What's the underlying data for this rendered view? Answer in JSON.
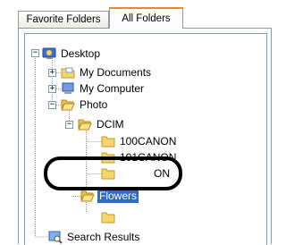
{
  "tabs": [
    {
      "label": "Favorite Folders",
      "active": false
    },
    {
      "label": "All Folders",
      "active": true
    }
  ],
  "tree": {
    "desktop": {
      "label": "Desktop",
      "icon": "desktop-icon",
      "expanded": true
    },
    "my_documents": {
      "label": "My Documents",
      "icon": "my-documents-folder-icon",
      "expanded": false
    },
    "my_computer": {
      "label": "My Computer",
      "icon": "computer-icon",
      "expanded": false
    },
    "photo": {
      "label": "Photo",
      "icon": "folder-open-icon",
      "expanded": true
    },
    "dcim": {
      "label": "DCIM",
      "icon": "folder-open-icon",
      "expanded": true
    },
    "canon100": {
      "label": "100CANON",
      "icon": "folder-icon"
    },
    "canon101": {
      "label": "101CANON",
      "icon": "folder-icon"
    },
    "canon102_partial": {
      "label": "ON",
      "icon": "folder-icon"
    },
    "flowers": {
      "label": "Flowers",
      "icon": "folder-open-icon",
      "selected": true
    },
    "hidden_item_partial": {
      "label": "",
      "icon": "folder-icon"
    },
    "search_results": {
      "label": "Search Results",
      "icon": "search-results-icon"
    }
  },
  "colors": {
    "selection": "#316ac5",
    "folder": "#f5d66b",
    "tab_accent": "#e68b2c"
  }
}
